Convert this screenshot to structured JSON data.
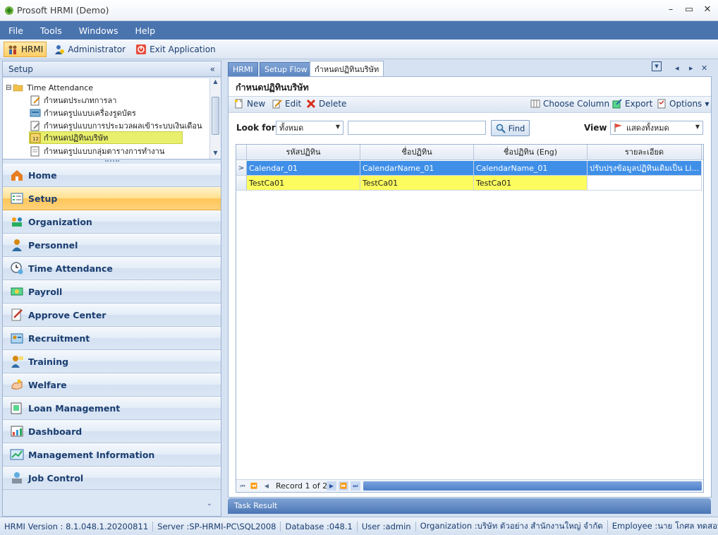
{
  "window": {
    "title": "Prosoft HRMI (Demo)",
    "minimize": "–",
    "restore": "▭",
    "close": "✕"
  },
  "menu": [
    "File",
    "Tools",
    "Windows",
    "Help"
  ],
  "toolbar": {
    "hrmi": "HRMI",
    "administrator": "Administrator",
    "exit": "Exit Application"
  },
  "left_panel": {
    "title": "Setup",
    "collapse": "«",
    "tree": {
      "root": "Time Attendance",
      "items": [
        "กำหนดประเภทการลา",
        "กำหนดรูปแบบเครื่องรูดบัตร",
        "กำหนดรูปแบบการประมวลผลเข้าระบบเงินเดือน",
        "กำหนดปฏิทินบริษัท",
        "กำหนดรูปแบบกลุ่มตารางการทำงาน"
      ],
      "selected_index": 3
    },
    "nav": [
      "Home",
      "Setup",
      "Organization",
      "Personnel",
      "Time Attendance",
      "Payroll",
      "Approve Center",
      "Recruitment",
      "Training",
      "Welfare",
      "Loan Management",
      "Dashboard",
      "Management Information",
      "Job Control"
    ],
    "active_nav": "Setup",
    "more": "⌄"
  },
  "tabs": [
    {
      "label": "HRMI",
      "active": false
    },
    {
      "label": "Setup Flow",
      "active": false
    },
    {
      "label": "กำหนดปฏิทินบริษัท",
      "active": true
    }
  ],
  "tab_controls": {
    "menu": "▾",
    "prev": "◂",
    "next": "▸",
    "close": "✕"
  },
  "page": {
    "title": "กำหนดปฏิทินบริษัท",
    "actions": {
      "new": "New",
      "edit": "Edit",
      "delete": "Delete",
      "choose_column": "Choose Column",
      "export": "Export",
      "options": "Options"
    },
    "filter": {
      "look_for_label": "Look for",
      "look_for_value": "ทั้งหมด",
      "search_value": "",
      "find_label": "Find",
      "view_label": "View",
      "view_value": "แสดงทั้งหมด"
    },
    "grid": {
      "columns": [
        "รหัสปฏิทิน",
        "ชื่อปฏิทิน",
        "ชื่อปฏิทิน (Eng)",
        "รายละเอียด"
      ],
      "rows": [
        [
          "Calendar_01",
          "CalendarName_01",
          "CalendarName_01",
          "ปรับปรุงข้อมูลปฏิทินเดิมเป็น Li..."
        ],
        [
          "TestCa01",
          "TestCa01",
          "TestCa01",
          ""
        ]
      ],
      "selected_row": 0,
      "row_indicator": ">",
      "record_text": "Record 1 of 2"
    },
    "task_result": "Task Result"
  },
  "status": {
    "version": "HRMI Version : 8.1.048.1.20200811",
    "server": "Server :SP-HRMI-PC\\SQL2008",
    "database": "Database :048.1",
    "user": "User :admin",
    "organization": "Organization :บริษัท ตัวอย่าง สำนักงานใหญ่ จำกัด",
    "employee": "Employee :นาย โกศล ทดสอบ"
  },
  "colors": {
    "menu_bar": "#4a74ae",
    "active_nav": "#ffc55a",
    "selected_row": "#3f8fe8",
    "highlight_row": "#fcfc5e"
  }
}
